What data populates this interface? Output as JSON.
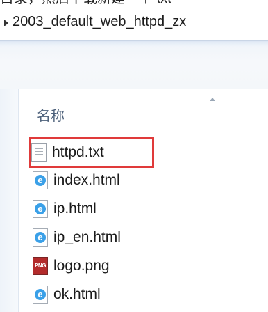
{
  "top_caption": "目录，然后下载新建一个 txt",
  "breadcrumb": {
    "folder": "2003_default_web_httpd_zx"
  },
  "columns": {
    "name": "名称"
  },
  "files": [
    {
      "name": "httpd.txt",
      "icon": "text-file-icon",
      "highlighted": true
    },
    {
      "name": "index.html",
      "icon": "html-file-icon"
    },
    {
      "name": "ip.html",
      "icon": "html-file-icon"
    },
    {
      "name": "ip_en.html",
      "icon": "html-file-icon"
    },
    {
      "name": "logo.png",
      "icon": "png-file-icon"
    },
    {
      "name": "ok.html",
      "icon": "html-file-icon"
    }
  ],
  "colors": {
    "highlight_border": "#e03a3a",
    "html_icon": "#3aa0e8",
    "png_icon": "#b32b2b"
  }
}
